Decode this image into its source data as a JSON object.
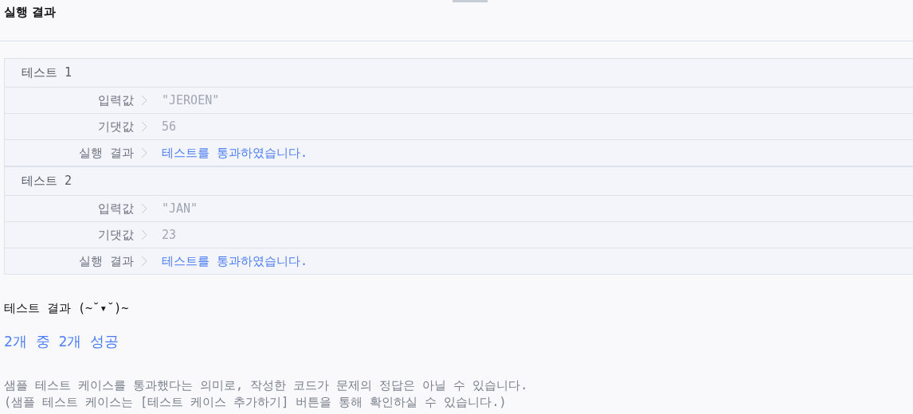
{
  "title": "실행 결과",
  "tests": [
    {
      "name": "테스트 1",
      "rows": [
        {
          "label": "입력값",
          "value": "\"JEROEN\"",
          "kind": "value"
        },
        {
          "label": "기댓값",
          "value": "56",
          "kind": "value"
        },
        {
          "label": "실행 결과",
          "value": "테스트를 통과하였습니다.",
          "kind": "result"
        }
      ]
    },
    {
      "name": "테스트 2",
      "rows": [
        {
          "label": "입력값",
          "value": "\"JAN\"",
          "kind": "value"
        },
        {
          "label": "기댓값",
          "value": "23",
          "kind": "value"
        },
        {
          "label": "실행 결과",
          "value": "테스트를 통과하였습니다.",
          "kind": "result"
        }
      ]
    }
  ],
  "summary": {
    "heading": "테스트 결과 (~˘▾˘)~",
    "score": "2개 중 2개 성공"
  },
  "notes": [
    "샘플 테스트 케이스를 통과했다는 의미로, 작성한 코드가 문제의 정답은 아닐 수 있습니다.",
    "(샘플 테스트 케이스는 [테스트 케이스 추가하기] 버튼을 통해 확인하실 수 있습니다.)"
  ]
}
